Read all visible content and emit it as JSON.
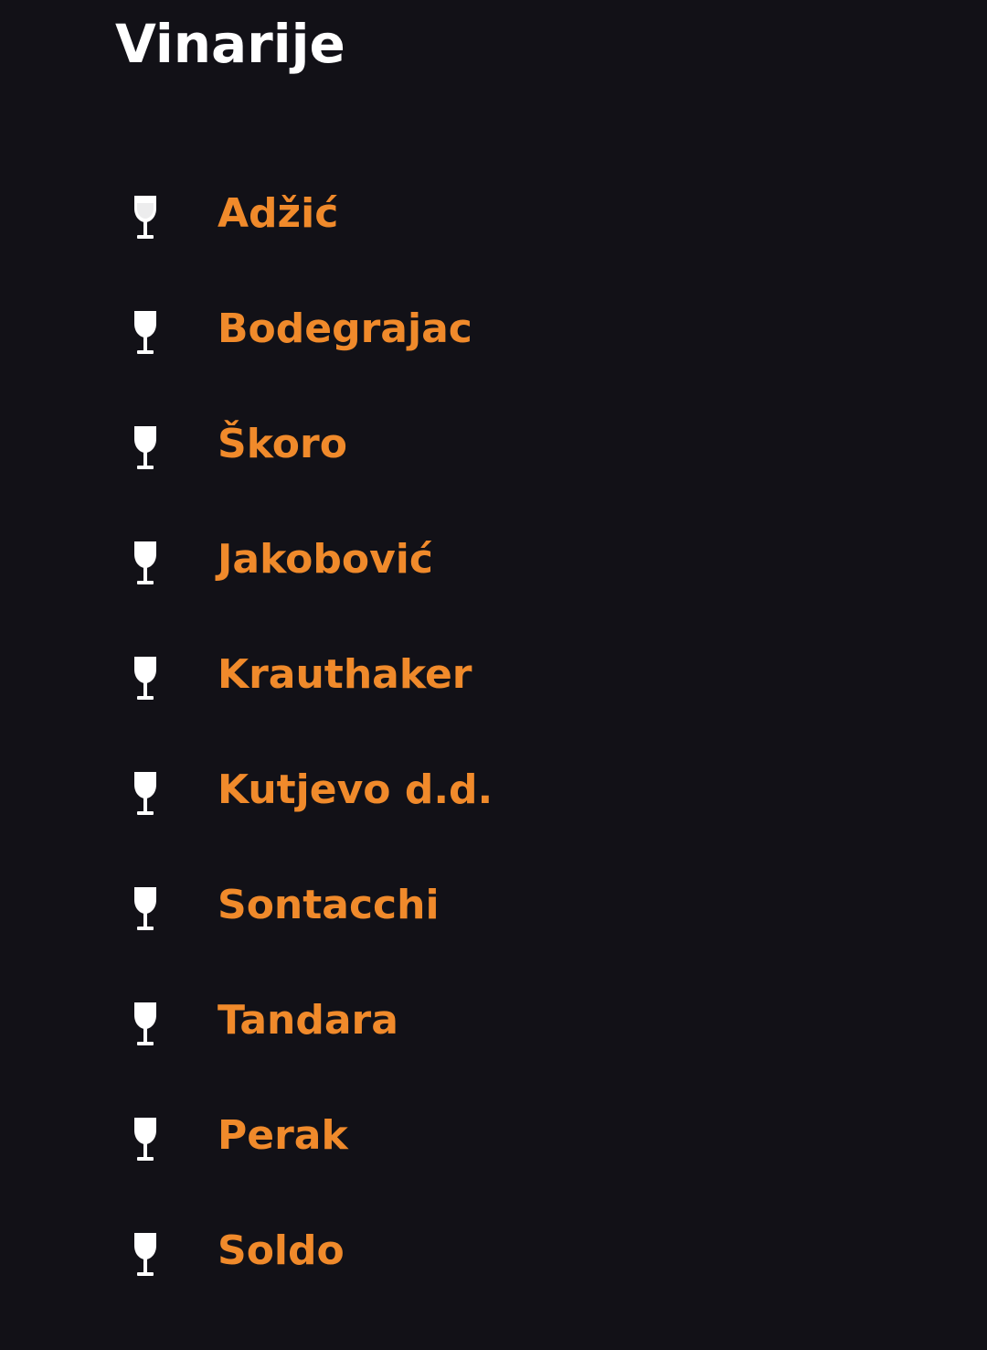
{
  "page": {
    "title": "Vinarije"
  },
  "colors": {
    "background": "#121117",
    "title": "#ffffff",
    "accent": "#f08a2b",
    "icon": "#ffffff"
  },
  "wineries": [
    {
      "label": "Adžić",
      "icon": "wine-glass-icon"
    },
    {
      "label": "Bodegrajac",
      "icon": "wine-glass-icon"
    },
    {
      "label": "Škoro",
      "icon": "wine-glass-icon"
    },
    {
      "label": "Jakobović",
      "icon": "wine-glass-icon"
    },
    {
      "label": "Krauthaker",
      "icon": "wine-glass-icon"
    },
    {
      "label": "Kutjevo d.d.",
      "icon": "wine-glass-icon"
    },
    {
      "label": "Sontacchi",
      "icon": "wine-glass-icon"
    },
    {
      "label": "Tandara",
      "icon": "wine-glass-icon"
    },
    {
      "label": "Perak",
      "icon": "wine-glass-icon"
    },
    {
      "label": "Soldo",
      "icon": "wine-glass-icon"
    }
  ]
}
